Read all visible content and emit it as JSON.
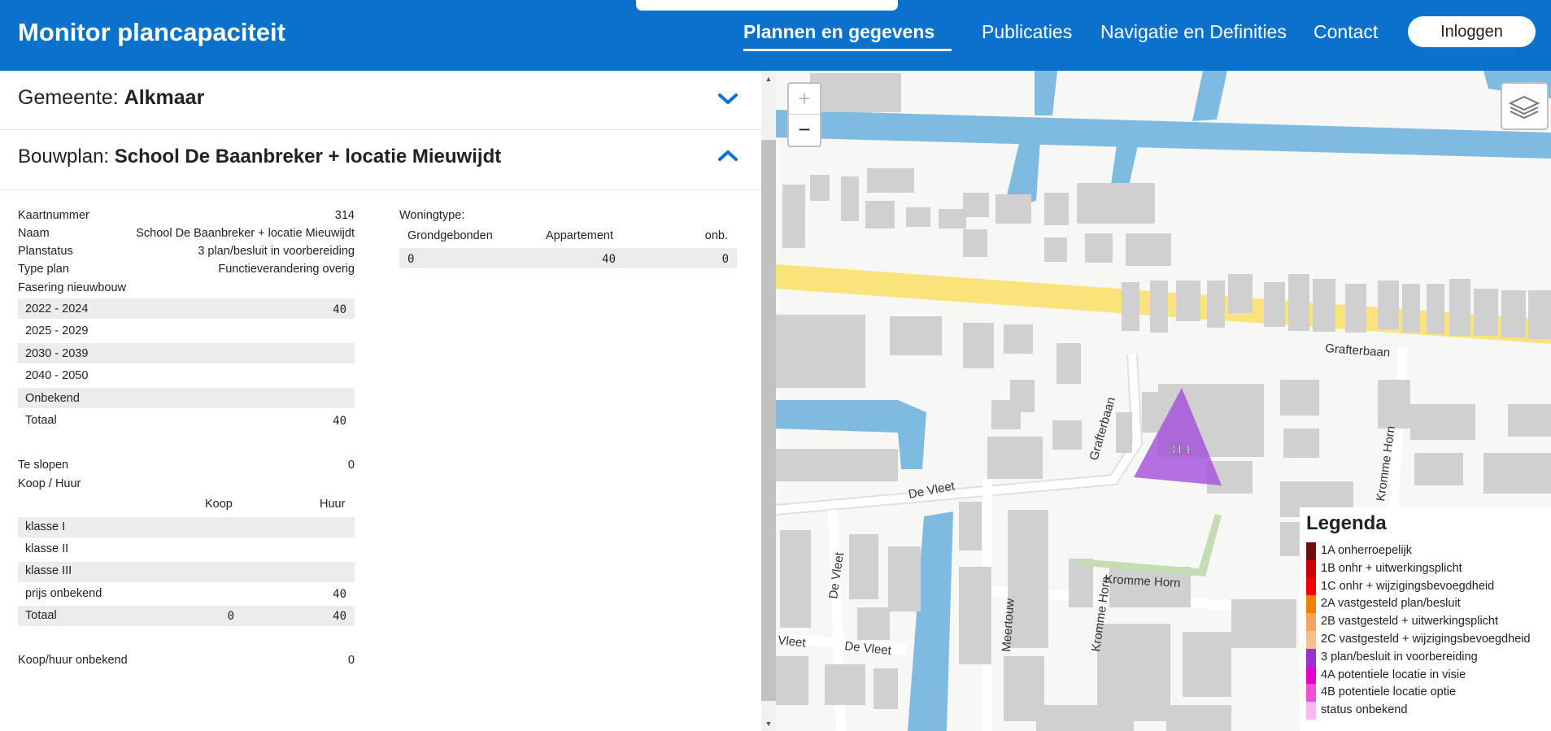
{
  "header": {
    "title": "Monitor plancapaciteit",
    "nav": [
      "Plannen en gegevens",
      "Publicaties",
      "Navigatie en Definities",
      "Contact"
    ],
    "login": "Inloggen"
  },
  "gemeente": {
    "label": "Gemeente:",
    "value": "Alkmaar"
  },
  "bouwplan": {
    "label": "Bouwplan:",
    "value": "School De Baanbreker + locatie Mieuwijdt"
  },
  "details": [
    {
      "label": "Kaartnummer",
      "value": "314"
    },
    {
      "label": "Naam",
      "value": "School De Baanbreker + locatie Mieuwijdt"
    },
    {
      "label": "Planstatus",
      "value": "3 plan/besluit in voorbereiding"
    },
    {
      "label": "Type plan",
      "value": "Functieverandering overig"
    }
  ],
  "fasering": {
    "title": "Fasering nieuwbouw",
    "rows": [
      {
        "label": "2022 - 2024",
        "value": "40"
      },
      {
        "label": "2025 - 2029",
        "value": ""
      },
      {
        "label": "2030 - 2039",
        "value": ""
      },
      {
        "label": "2040 - 2050",
        "value": ""
      },
      {
        "label": "Onbekend",
        "value": ""
      },
      {
        "label": "Totaal",
        "value": "40"
      }
    ]
  },
  "te_slopen": {
    "label": "Te slopen",
    "value": "0"
  },
  "koop_huur": {
    "title": "Koop / Huur",
    "col_koop": "Koop",
    "col_huur": "Huur",
    "rows": [
      {
        "label": "klasse I",
        "koop": "",
        "huur": ""
      },
      {
        "label": "klasse II",
        "koop": "",
        "huur": ""
      },
      {
        "label": "klasse III",
        "koop": "",
        "huur": ""
      },
      {
        "label": "prijs onbekend",
        "koop": "",
        "huur": "40"
      },
      {
        "label": "Totaal",
        "koop": "0",
        "huur": "40"
      }
    ]
  },
  "koop_huur_onbekend": {
    "label": "Koop/huur onbekend",
    "value": "0"
  },
  "woningtype": {
    "title": "Woningtype:",
    "headers": [
      "Grondgebonden",
      "Appartement",
      "onb."
    ],
    "values": [
      "0",
      "40",
      "0"
    ]
  },
  "map": {
    "zoom_in": "+",
    "zoom_out": "−",
    "plan_marker": "314",
    "streets": [
      "Grafterbaan",
      "Grafterbaan",
      "Kromme Horn",
      "Kromme Horn",
      "Kromme Horn",
      "De Vleet",
      "De Vleet",
      "De Vleet",
      "Vleet",
      "Meertouw"
    ],
    "legend": {
      "title": "Legenda",
      "items": [
        {
          "label": "1A onherroepelijk",
          "color": "#6b0f0f"
        },
        {
          "label": "1B onhr + uitwerkingsplicht",
          "color": "#cc0000"
        },
        {
          "label": "1C onhr + wijzigingsbevoegdheid",
          "color": "#f20000"
        },
        {
          "label": "2A vastgesteld plan/besluit",
          "color": "#f08000"
        },
        {
          "label": "2B vastgesteld + uitwerkingsplicht",
          "color": "#f4a460"
        },
        {
          "label": "2C vastgesteld + wijzigingsbevoegdheid",
          "color": "#f7c08a"
        },
        {
          "label": "3 plan/besluit in voorbereiding",
          "color": "#9b30d9"
        },
        {
          "label": "4A potentiele locatie in visie",
          "color": "#e600cc"
        },
        {
          "label": "4B potentiele locatie optie",
          "color": "#f050d8"
        },
        {
          "label": "status onbekend",
          "color": "#f8b8f0"
        }
      ]
    }
  }
}
